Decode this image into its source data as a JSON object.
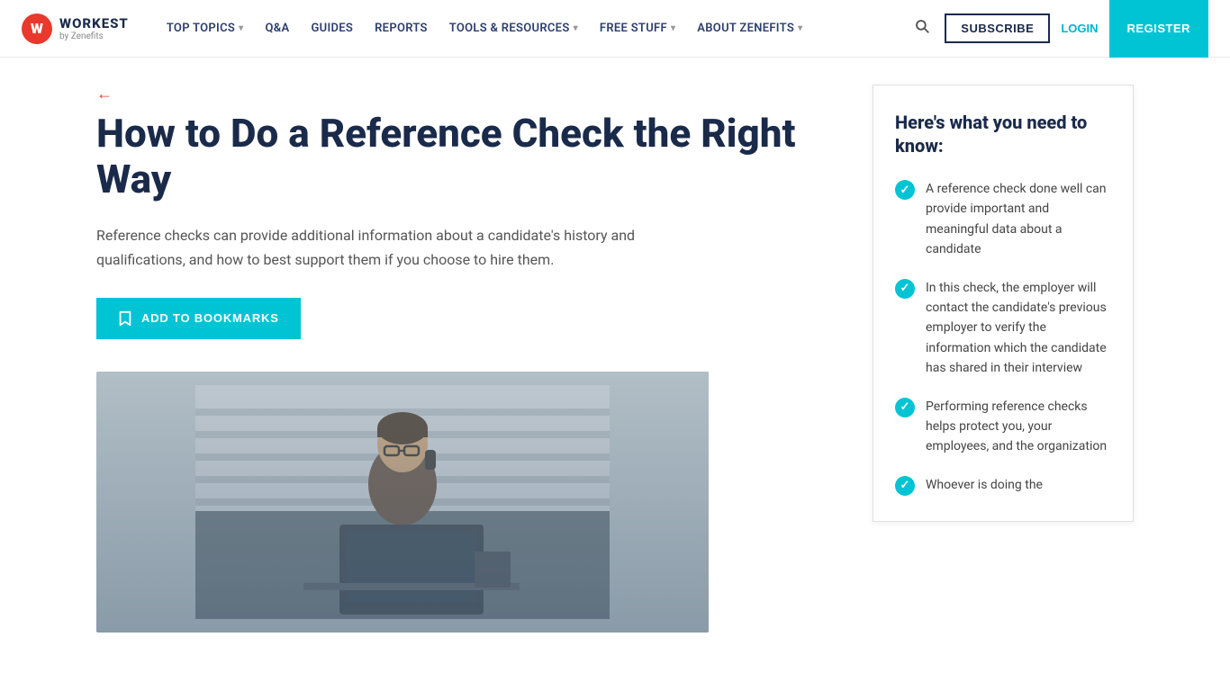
{
  "brand": {
    "logo_letter": "W",
    "logo_title": "WORKEST",
    "logo_subtitle": "by Zenefits"
  },
  "nav": {
    "items": [
      {
        "label": "TOP TOPICS",
        "has_dropdown": true
      },
      {
        "label": "Q&A",
        "has_dropdown": false
      },
      {
        "label": "GUIDES",
        "has_dropdown": false
      },
      {
        "label": "REPORTS",
        "has_dropdown": false
      },
      {
        "label": "TOOLS & RESOURCES",
        "has_dropdown": true
      },
      {
        "label": "FREE STUFF",
        "has_dropdown": true
      },
      {
        "label": "ABOUT ZENEFITS",
        "has_dropdown": true
      }
    ],
    "subscribe_label": "SUBSCRIBE",
    "login_label": "LOGIN",
    "register_label": "REGISTER"
  },
  "article": {
    "back_arrow": "←",
    "title": "How to Do a Reference Check the Right Way",
    "intro": "Reference checks can provide additional information about a candidate's history and qualifications, and how to best support them if you choose to hire them.",
    "bookmark_label": "ADD TO BOOKMARKS"
  },
  "sidebar": {
    "heading": "Here's what you need to know:",
    "checklist": [
      {
        "text": "A reference check done well can provide important and meaningful data about a candidate"
      },
      {
        "text": "In this check, the employer will contact the candidate's previous employer to verify the information which the candidate has shared in their interview"
      },
      {
        "text": "Performing reference checks helps protect you, your employees, and the organization"
      },
      {
        "text": "Whoever is doing the"
      }
    ]
  }
}
